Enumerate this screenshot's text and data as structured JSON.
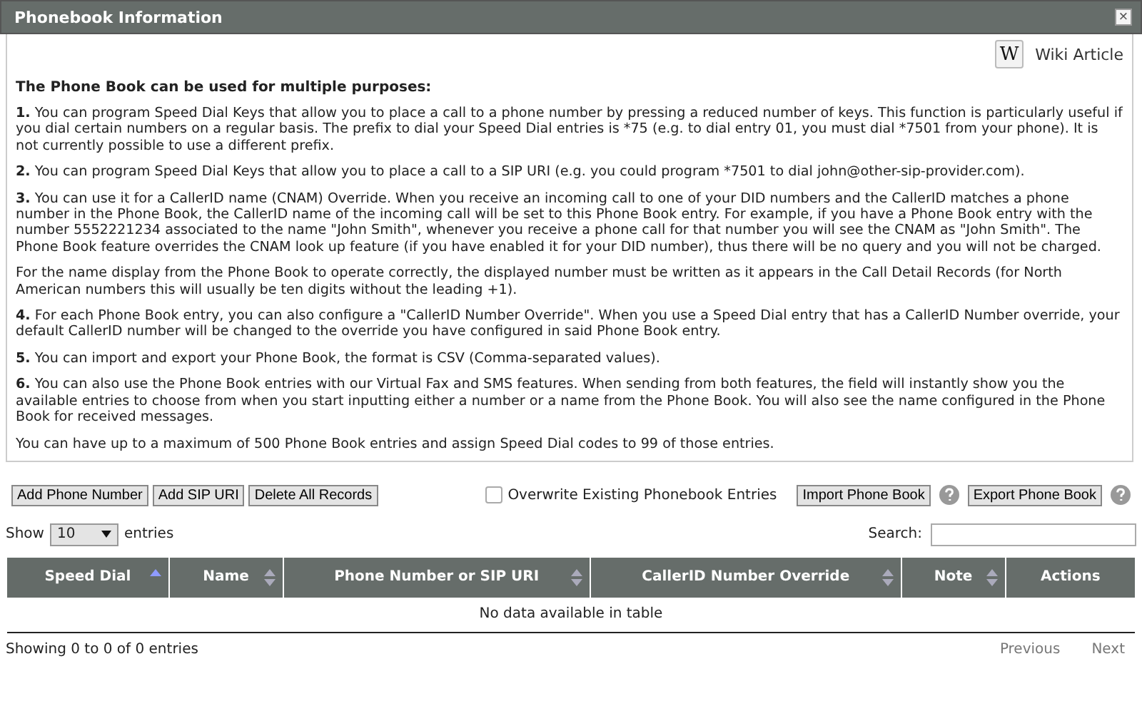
{
  "window": {
    "title": "Phonebook Information",
    "close_label": "×"
  },
  "wiki": {
    "icon_letter": "W",
    "label": "Wiki Article"
  },
  "intro_heading": "The Phone Book can be used for multiple purposes:",
  "paragraphs": [
    "**1.** You can program Speed Dial Keys that allow you to place a call to a phone number by pressing a reduced number of keys. This function is particularly useful if you dial certain numbers on a regular basis. The prefix to dial your Speed Dial entries is *75 (e.g. to dial entry 01, you must dial *7501 from your phone). It is not currently possible to use a different prefix.",
    "**2.** You can program Speed Dial Keys that allow you to place a call to a SIP URI (e.g. you could program *7501 to dial john@other-sip-provider.com).",
    "**3.** You can use it for a CallerID name (CNAM) Override. When you receive an incoming call to one of your DID numbers and the CallerID matches a phone number in the Phone Book, the CallerID name of the incoming call will be set to this Phone Book entry. For example, if you have a Phone Book entry with the number 5552221234 associated to the name \"John Smith\", whenever you receive a phone call for that number you will see the CNAM as \"John Smith\". The Phone Book feature overrides the CNAM look up feature (if you have enabled it for your DID number), thus there will be no query and you will not be charged.",
    "For the name display from the Phone Book to operate correctly, the displayed number must be written as it appears in the Call Detail Records (for North American numbers this will usually be ten digits without the leading +1).",
    "**4.** For each Phone Book entry, you can also configure a \"CallerID Number Override\". When you use a Speed Dial entry that has a CallerID Number override, your default CallerID number will be changed to the override you have configured in said Phone Book entry.",
    "**5.** You can import and export your Phone Book, the format is CSV (Comma-separated values).",
    "**6.** You can also use the Phone Book entries with our Virtual Fax and SMS features. When sending from both features, the field will instantly show you the available entries to choose from when you start inputting either a number or a name from the Phone Book. You will also see the name configured in the Phone Book for received messages.",
    "You can have up to a maximum of 500 Phone Book entries and assign Speed Dial codes to 99 of those entries."
  ],
  "actions": [
    "Add Phone Number",
    "Add SIP URI",
    "Delete All Records"
  ],
  "overwrite": {
    "label": "Overwrite Existing Phonebook Entries",
    "checked": false
  },
  "import_button": "Import Phone Book",
  "export_button": "Export Phone Book",
  "length": {
    "before": "Show",
    "value": "10",
    "after": "entries"
  },
  "search": {
    "label": "Search:"
  },
  "table": {
    "columns": [
      {
        "label": "Speed Dial",
        "sortable": true,
        "sorted_ascending": true
      },
      {
        "label": "Name",
        "sortable": true,
        "sorted_ascending": false
      },
      {
        "label": "Phone Number or SIP URI",
        "sortable": true,
        "sorted_ascending": false
      },
      {
        "label": "CallerID Number Override",
        "sortable": true,
        "sorted_ascending": false
      },
      {
        "label": "Note",
        "sortable": true,
        "sorted_ascending": false
      },
      {
        "label": "Actions",
        "sortable": false
      }
    ],
    "empty_message": "No data available in table"
  },
  "info": "Showing 0 to 0 of 0 entries",
  "pager": [
    {
      "label": "Previous",
      "disabled": true
    },
    {
      "label": "Next",
      "disabled": true
    }
  ]
}
